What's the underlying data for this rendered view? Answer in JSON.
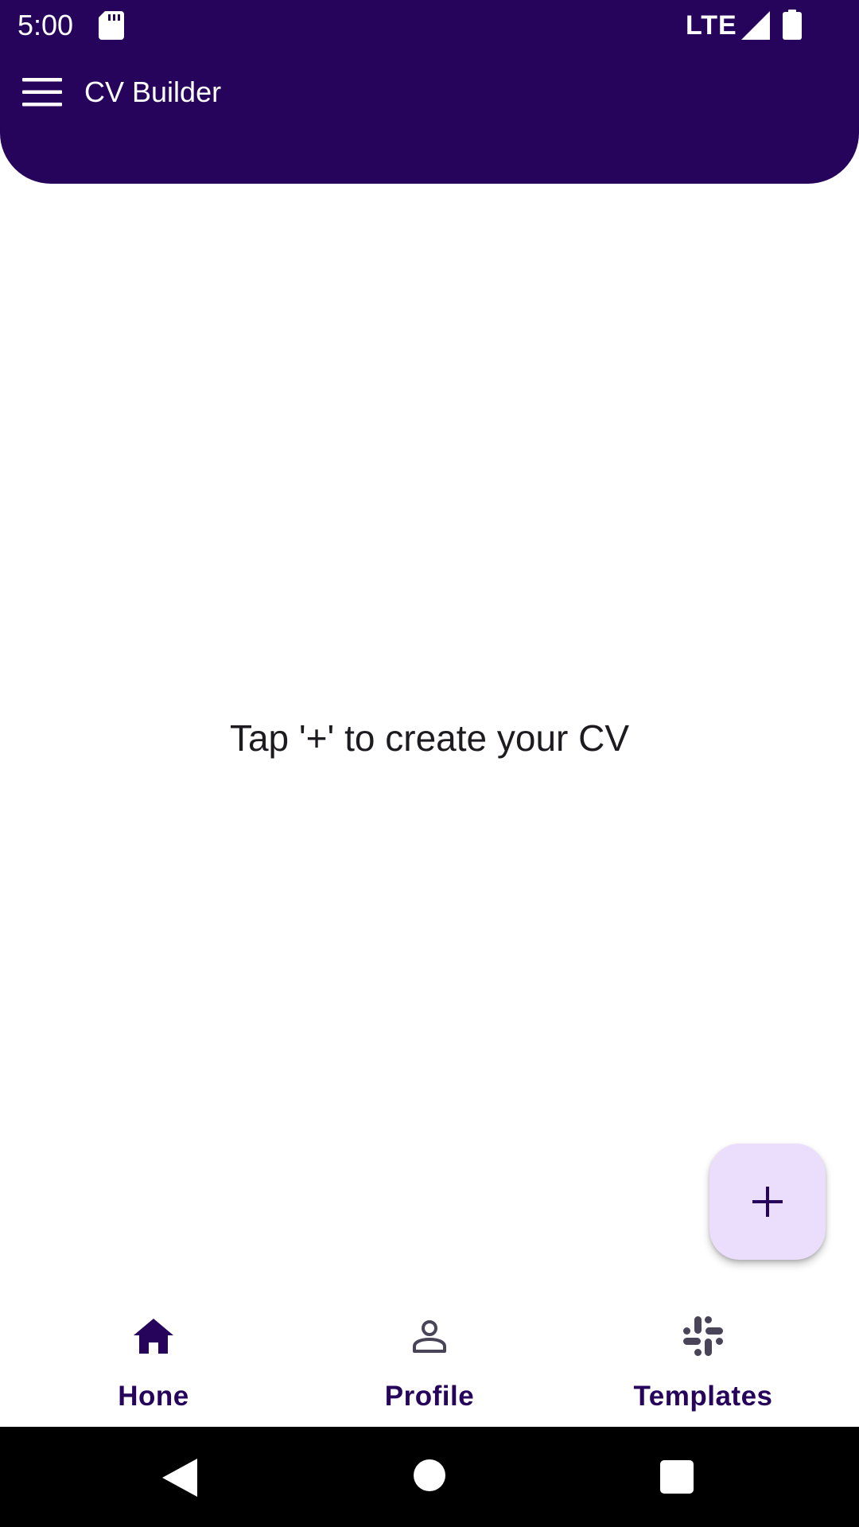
{
  "status_bar": {
    "time": "5:00",
    "network": "LTE",
    "icons": [
      "sd-card-icon",
      "signal-icon",
      "battery-icon"
    ]
  },
  "app_bar": {
    "title": "CV Builder",
    "menu_icon": "menu-icon",
    "background_color": "#26045c"
  },
  "main": {
    "empty_message": "Tap '+' to create your CV"
  },
  "fab": {
    "icon": "plus-icon",
    "background_color": "#ebddfc"
  },
  "bottom_nav": {
    "items": [
      {
        "label": "Hone",
        "icon": "home-icon",
        "selected": true
      },
      {
        "label": "Profile",
        "icon": "person-icon",
        "selected": false
      },
      {
        "label": "Templates",
        "icon": "slack-icon",
        "selected": false
      }
    ],
    "label_color": "#26045c"
  },
  "system_nav": {
    "icons": [
      "back-icon",
      "home-circle-icon",
      "recents-icon"
    ]
  }
}
